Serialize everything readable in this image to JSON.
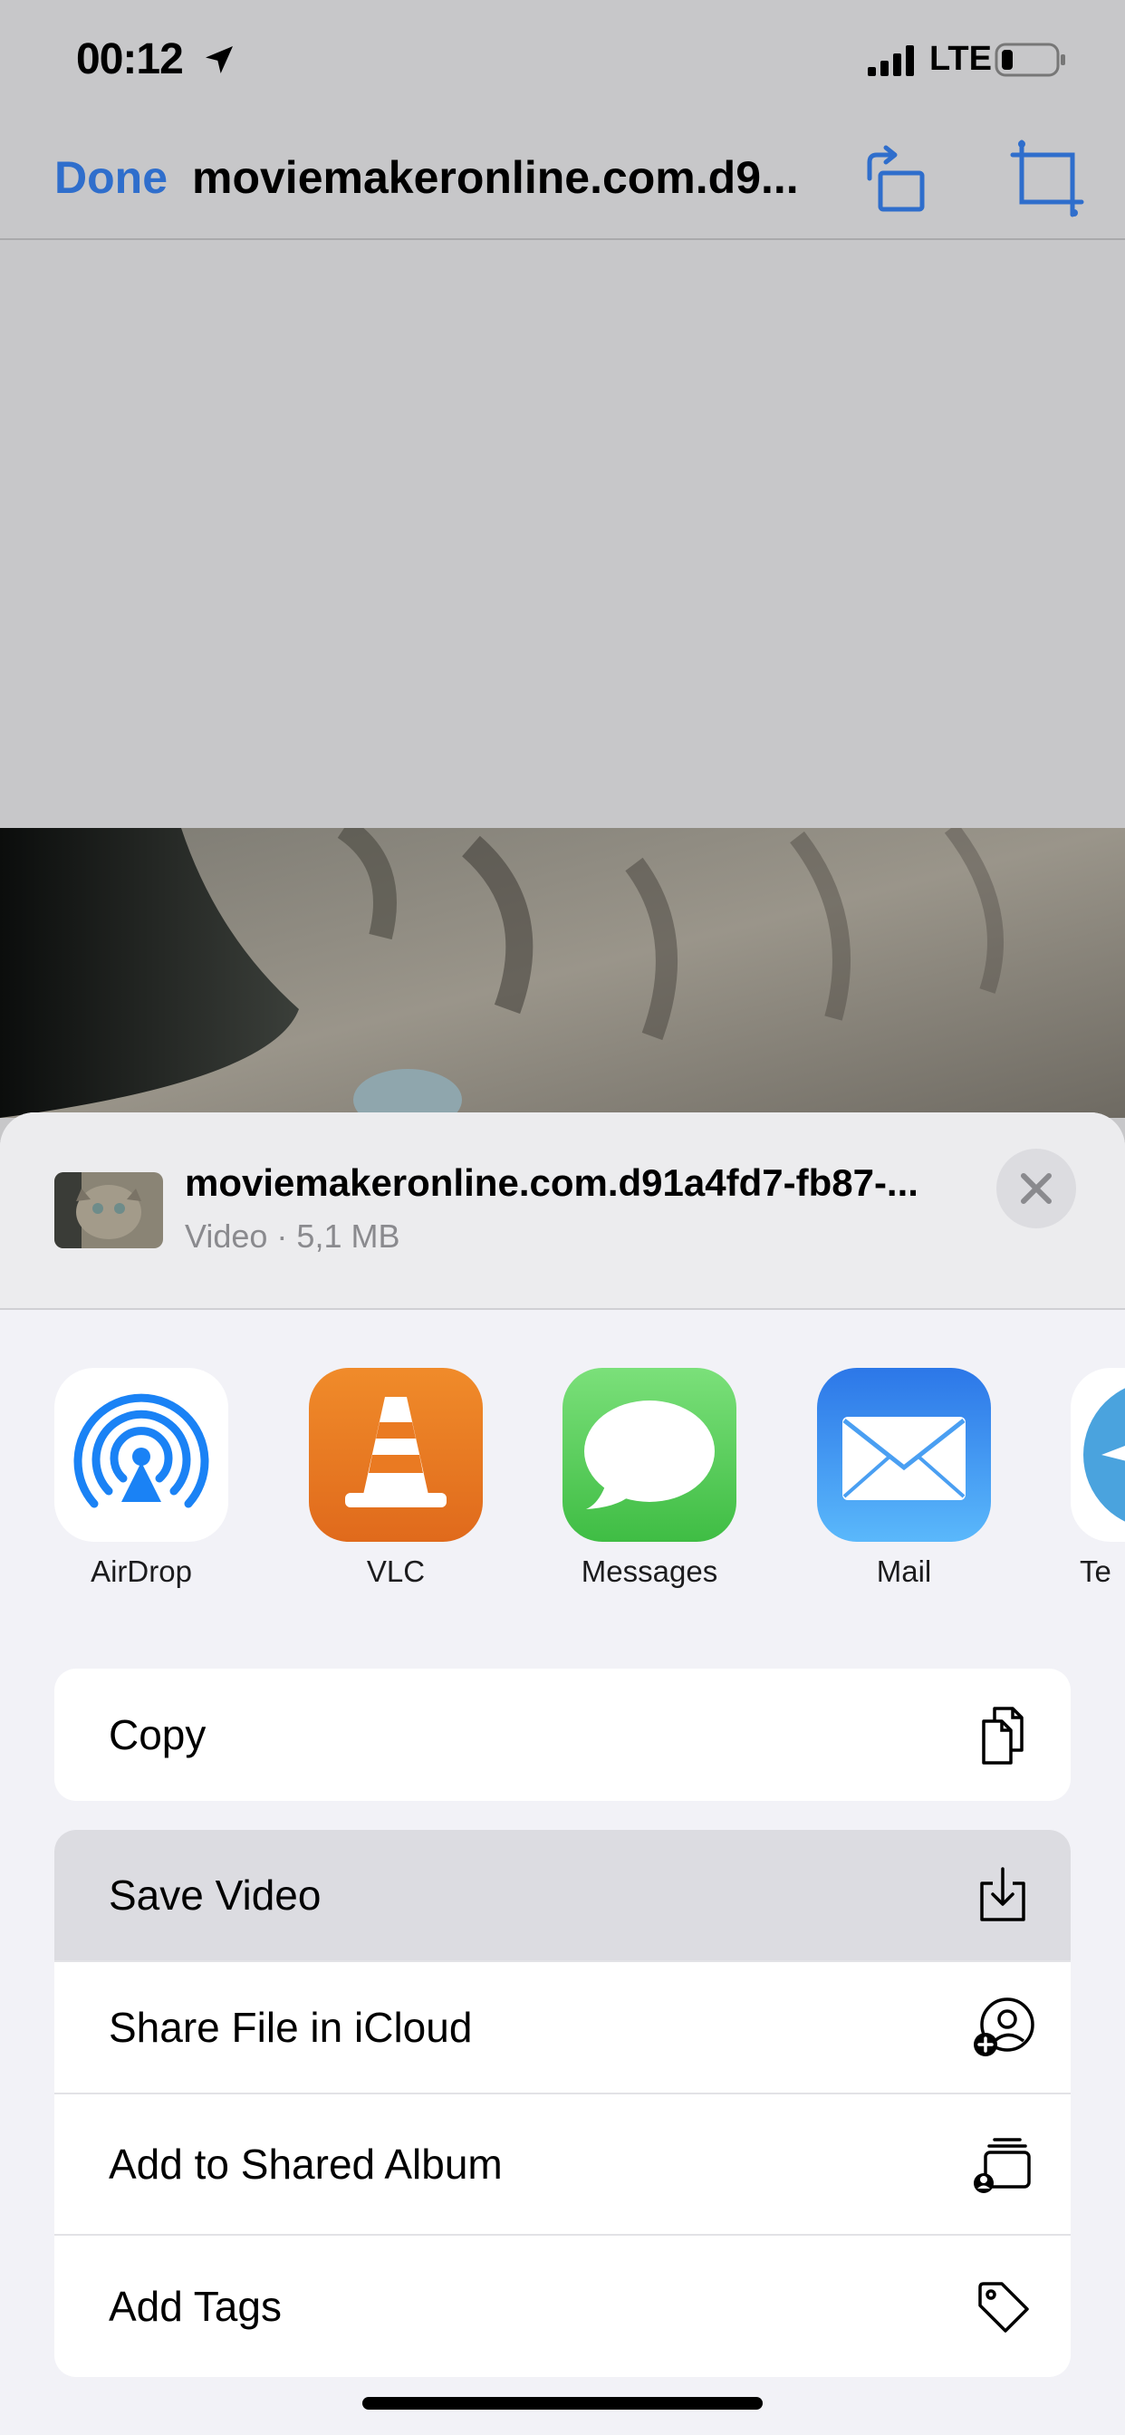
{
  "status_bar": {
    "time": "00:12",
    "network": "LTE",
    "icons": [
      "location-arrow-icon",
      "cellular-signal-icon",
      "battery-icon"
    ]
  },
  "nav": {
    "done_label": "Done",
    "title": "moviemakeronline.com.d9...",
    "icons": [
      "rotate-icon",
      "crop-icon"
    ],
    "accent_color": "#2f6ecc"
  },
  "share_sheet": {
    "file_name": "moviemakeronline.com.d91a4fd7-fb87-...",
    "file_meta": "Video · 5,1 MB",
    "apps": [
      {
        "label": "AirDrop",
        "icon": "airdrop-icon"
      },
      {
        "label": "VLC",
        "icon": "vlc-cone-icon"
      },
      {
        "label": "Messages",
        "icon": "messages-bubble-icon"
      },
      {
        "label": "Mail",
        "icon": "mail-envelope-icon"
      },
      {
        "label": "Te",
        "icon": "telegram-icon"
      }
    ],
    "actions_group1": [
      {
        "label": "Copy",
        "icon": "copy-icon"
      }
    ],
    "actions_group2": [
      {
        "label": "Save Video",
        "icon": "save-download-icon",
        "highlighted": true
      },
      {
        "label": "Share File in iCloud",
        "icon": "icloud-share-person-icon"
      },
      {
        "label": "Add to Shared Album",
        "icon": "shared-album-icon"
      },
      {
        "label": "Add Tags",
        "icon": "tag-icon"
      }
    ]
  }
}
